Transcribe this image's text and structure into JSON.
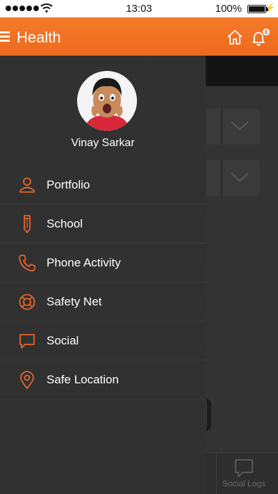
{
  "status_bar": {
    "time": "13:03",
    "battery": "100%"
  },
  "header": {
    "title": "Health",
    "notification_count": "8"
  },
  "user": {
    "name": "Vinay Sarkar"
  },
  "menu": [
    {
      "label": "Portfolio",
      "icon": "person-icon"
    },
    {
      "label": "School",
      "icon": "pencil-icon"
    },
    {
      "label": "Phone Activity",
      "icon": "phone-icon"
    },
    {
      "label": "Safety Net",
      "icon": "lifebuoy-icon"
    },
    {
      "label": "Social",
      "icon": "chat-bubble-icon"
    },
    {
      "label": "Safe Location",
      "icon": "location-pin-icon"
    }
  ],
  "background_page": {
    "bottom_tab_label": "Social Logs"
  },
  "colors": {
    "accent": "#ee6a1e",
    "drawer_bg": "#2f2f2f",
    "icon": "#e8662a"
  }
}
